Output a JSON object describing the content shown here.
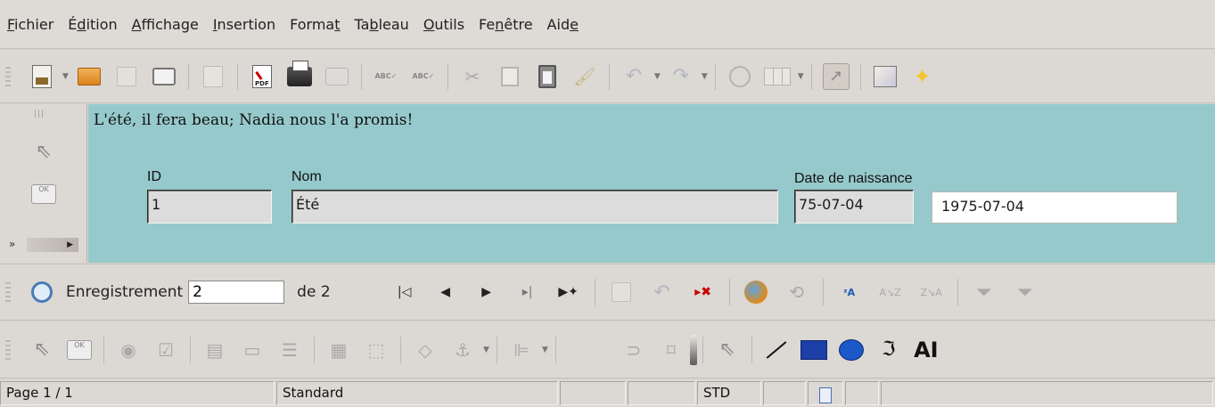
{
  "menubar": {
    "items": [
      {
        "label": "Fichier",
        "accel": "F",
        "rest": "ichier",
        "pre": ""
      },
      {
        "label": "Édition",
        "accel": "d",
        "pre": "É",
        "rest": "ition"
      },
      {
        "label": "Affichage",
        "accel": "A",
        "pre": "",
        "rest": "ffichage"
      },
      {
        "label": "Insertion",
        "accel": "I",
        "pre": "",
        "rest": "nsertion"
      },
      {
        "label": "Format",
        "accel": "t",
        "pre": "Forma",
        "rest": ""
      },
      {
        "label": "Tableau",
        "accel": "b",
        "pre": "Ta",
        "rest": "leau"
      },
      {
        "label": "Outils",
        "accel": "O",
        "pre": "",
        "rest": "utils"
      },
      {
        "label": "Fenêtre",
        "accel": "n",
        "pre": "Fe",
        "rest": "être"
      },
      {
        "label": "Aide",
        "accel": "e",
        "pre": "Aid",
        "rest": ""
      }
    ]
  },
  "form": {
    "title": "L'été, il fera beau; Nadia nous l'a promis!",
    "id_label": "ID",
    "id_value": "1",
    "nom_label": "Nom",
    "nom_value": "Été",
    "date_label": "Date de naissance",
    "date_short": "75-07-04",
    "date_long": "1975-07-04"
  },
  "navigation": {
    "record_label": "Enregistrement",
    "record_value": "2",
    "of_label": "de 2"
  },
  "statusbar": {
    "page": "Page 1 / 1",
    "style": "Standard",
    "mode": "STD"
  },
  "colors": {
    "form_background": "#96c9cb",
    "toolbar_background": "#dcd8d3"
  },
  "icons": {
    "standard_toolbar": [
      "new-document-icon",
      "open-folder-icon",
      "save-icon",
      "email-icon",
      "edit-file-icon",
      "export-pdf-icon",
      "print-icon",
      "print-preview-icon",
      "spellcheck-icon",
      "autospellcheck-icon",
      "cut-icon",
      "copy-icon",
      "paste-icon",
      "clone-format-icon",
      "undo-icon",
      "redo-icon",
      "navigator-icon",
      "table-icon",
      "design-mode-icon",
      "gallery-icon",
      "star-icon"
    ],
    "nav_toolbar": [
      "search-record-icon",
      "first-record-icon",
      "previous-record-icon",
      "next-record-icon",
      "last-record-icon",
      "new-record-icon",
      "save-record-icon",
      "undo-record-icon",
      "delete-record-icon",
      "refresh-icon",
      "refresh-control-icon",
      "sort-icon",
      "sort-ascending-icon",
      "sort-descending-icon",
      "autofilter-icon",
      "filter-icon"
    ],
    "draw_toolbar": [
      "select-pointer-icon",
      "push-button-icon",
      "option-button-icon",
      "checkbox-icon",
      "form-design-icon",
      "text-box-icon",
      "list-box-icon",
      "combo-box-icon",
      "group-box-icon",
      "anchor-icon",
      "align-icon",
      "wrap-icon",
      "frame-icon",
      "line-icon",
      "rectangle-icon",
      "ellipse-icon",
      "freeform-icon",
      "text-icon"
    ]
  }
}
